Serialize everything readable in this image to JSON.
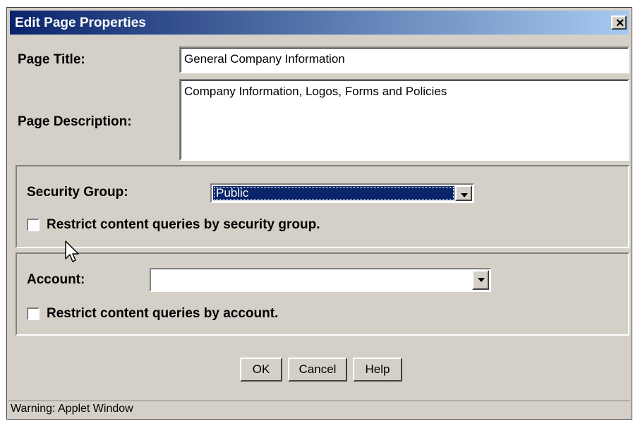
{
  "dialog": {
    "title": "Edit Page Properties",
    "close_icon": "close-icon"
  },
  "page_title": {
    "label": "Page Title:",
    "value": "General Company Information"
  },
  "page_description": {
    "label": "Page Description:",
    "value": "Company Information, Logos, Forms and Policies"
  },
  "security": {
    "label": "Security Group:",
    "selected": "Public",
    "restrict_label": "Restrict content queries by security group.",
    "restrict_checked": false
  },
  "account": {
    "label": "Account:",
    "selected": "",
    "restrict_label": "Restrict content queries by account.",
    "restrict_checked": false
  },
  "buttons": {
    "ok": "OK",
    "cancel": "Cancel",
    "help": "Help"
  },
  "status": {
    "text": "Warning: Applet Window"
  },
  "colors": {
    "titlebar_start": "#0a246a",
    "titlebar_end": "#a6caf0",
    "dialog_bg": "#d4d0c8",
    "selection": "#0a246a"
  }
}
